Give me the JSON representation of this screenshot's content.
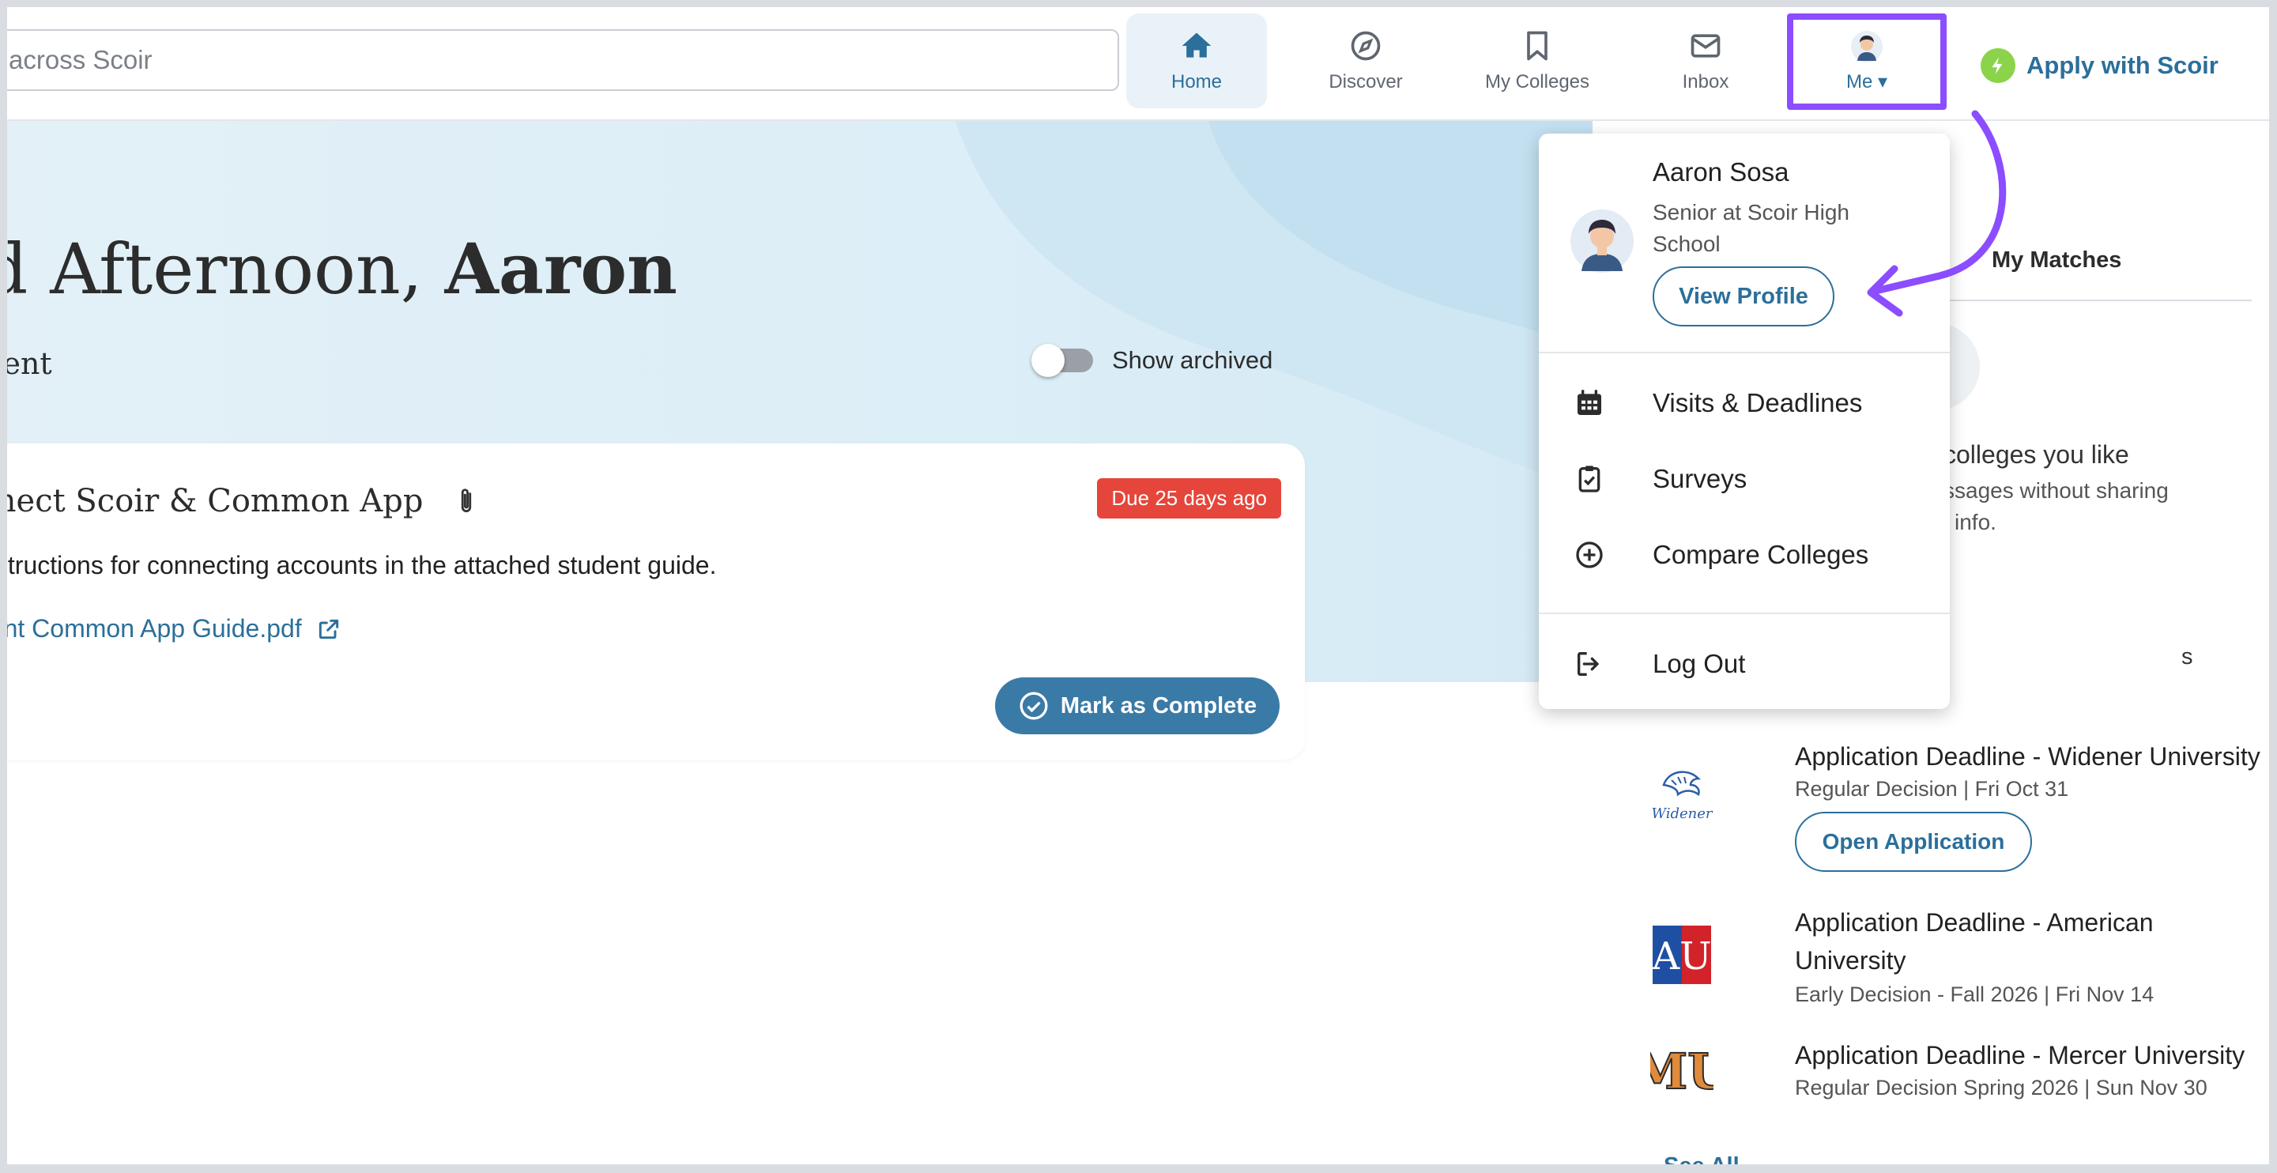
{
  "header": {
    "search_value": "across Scoir",
    "nav": {
      "home": "Home",
      "discover": "Discover",
      "my_colleges": "My Colleges",
      "inbox": "Inbox",
      "me": "Me"
    },
    "apply": "Apply with Scoir"
  },
  "hero": {
    "greeting_prefix": "d Afternoon, ",
    "greeting_name": "Aaron",
    "subhead": "nent",
    "show_archived": "Show archived"
  },
  "task": {
    "title": "nnect Scoir & Common App",
    "due": "Due 25 days ago",
    "instructions": "instructions for connecting accounts in the attached student guide.",
    "attachment": "dent Common App Guide.pdf",
    "mark_complete": "Mark as Complete"
  },
  "right_panel": {
    "tab": "My Matches",
    "like_line1": "colleges you like",
    "like_line2": "ssages without sharing",
    "like_line3": "l info.",
    "fragment": "s",
    "deadlines": [
      {
        "title": "Application Deadline - Widener University",
        "meta": "Regular Decision | Fri Oct 31",
        "button": "Open Application",
        "logo_text": "Widener"
      },
      {
        "title": "Application Deadline - American University",
        "meta": "Early Decision - Fall 2026 | Fri Nov 14",
        "logo_text": "AU"
      },
      {
        "title": "Application Deadline - Mercer University",
        "meta": "Regular Decision Spring 2026 | Sun Nov 30",
        "logo_text": "MU"
      }
    ],
    "see_all": "See All"
  },
  "me_menu": {
    "name": "Aaron Sosa",
    "role": "Senior at Scoir High School",
    "view_profile": "View Profile",
    "items": {
      "visits": "Visits & Deadlines",
      "surveys": "Surveys",
      "compare": "Compare Colleges",
      "logout": "Log Out"
    }
  },
  "colors": {
    "primary": "#2b6f9b",
    "highlight": "#8b4dff",
    "due_badge": "#e5453a",
    "apply_bolt": "#8bd34a"
  }
}
